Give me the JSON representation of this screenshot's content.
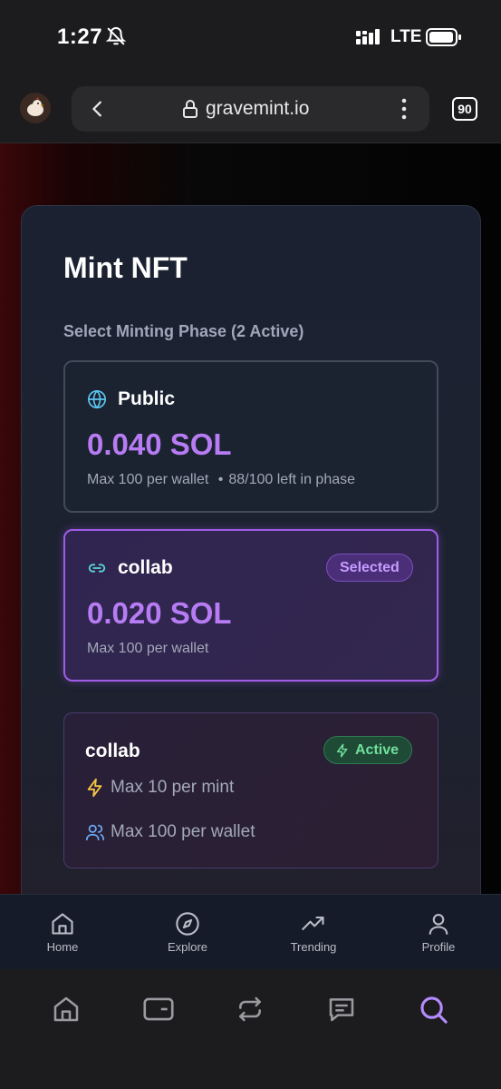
{
  "status_bar": {
    "time": "1:27",
    "network": "LTE"
  },
  "browser": {
    "url": "gravemint.io",
    "tab_count": "90"
  },
  "card": {
    "title": "Mint NFT",
    "section_label": "Select Minting Phase (2 Active)",
    "phases": [
      {
        "name": "Public",
        "price": "0.040 SOL",
        "limit": "Max 100 per wallet",
        "bullet": "•",
        "remaining": "88/100 left in phase"
      },
      {
        "name": "collab",
        "price": "0.020 SOL",
        "limit": "Max 100 per wallet",
        "badge": "Selected"
      }
    ],
    "detail": {
      "name": "collab",
      "badge": "Active",
      "per_mint": "Max 10 per mint",
      "per_wallet": "Max 100 per wallet"
    }
  },
  "app_nav": [
    {
      "label": "Home",
      "icon": "home-icon"
    },
    {
      "label": "Explore",
      "icon": "compass-icon"
    },
    {
      "label": "Trending",
      "icon": "trending-icon"
    },
    {
      "label": "Profile",
      "icon": "user-icon"
    }
  ],
  "browser_toolbar": [
    {
      "icon": "home-icon"
    },
    {
      "icon": "wallet-icon"
    },
    {
      "icon": "swap-icon"
    },
    {
      "icon": "chat-icon"
    },
    {
      "icon": "search-icon",
      "color": "#b48cff"
    }
  ],
  "colors": {
    "accent_purple": "#b77cf4",
    "selected_border": "#a05ce8",
    "active_green": "#6fe09a"
  }
}
